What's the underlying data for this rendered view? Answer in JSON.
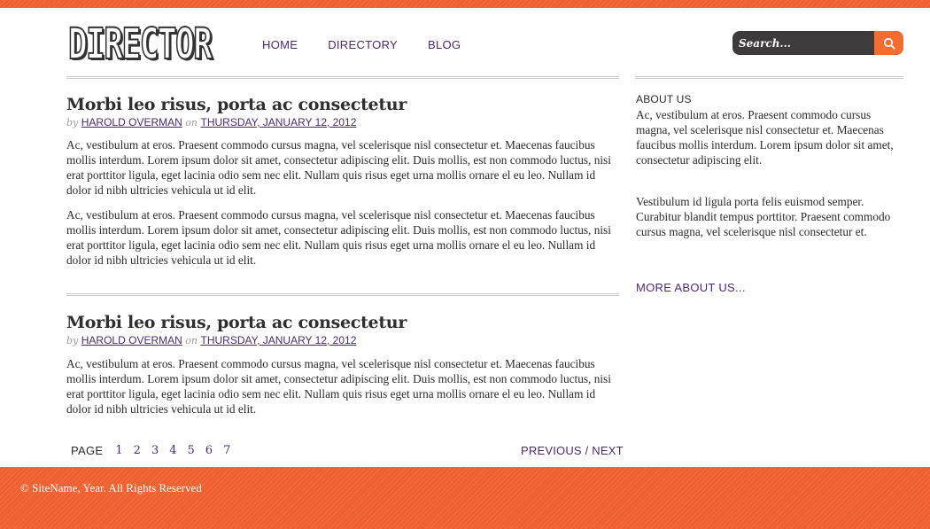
{
  "site": {
    "logo_text": "DIRECTOR"
  },
  "nav": {
    "items": [
      {
        "label": "HOME"
      },
      {
        "label": "DIRECTORY"
      },
      {
        "label": "BLOG"
      }
    ]
  },
  "search": {
    "placeholder": "Search...",
    "icon": "search-icon"
  },
  "posts": [
    {
      "title": "Morbi leo risus, porta ac consectetur",
      "by_word": "by",
      "author": "HAROLD OVERMAN",
      "on_word": "on",
      "date": "THURSDAY, JANUARY 12, 2012",
      "paragraphs": [
        "Ac, vestibulum at eros. Praesent commodo cursus magna, vel scelerisque nisl consectetur et. Maecenas faucibus mollis interdum. Lorem ipsum dolor sit amet, consectetur adipiscing elit. Duis mollis, est non commodo luctus, nisi erat porttitor ligula, eget lacinia odio sem nec elit. Nullam quis risus eget urna mollis ornare el eu leo. Nullam id dolor id nibh ultricies vehicula ut id elit.",
        "Ac, vestibulum at eros. Praesent commodo cursus magna, vel scelerisque nisl consectetur et. Maecenas faucibus mollis interdum. Lorem ipsum dolor sit amet, consectetur adipiscing elit. Duis mollis, est non commodo luctus, nisi erat porttitor ligula, eget lacinia odio sem nec elit. Nullam quis risus eget urna mollis ornare el eu leo. Nullam id dolor id nibh ultricies vehicula ut id elit."
      ]
    },
    {
      "title": "Morbi leo risus, porta ac consectetur",
      "by_word": "by",
      "author": "HAROLD OVERMAN",
      "on_word": "on",
      "date": "THURSDAY, JANUARY 12, 2012",
      "paragraphs": [
        "Ac, vestibulum at eros. Praesent commodo cursus magna, vel scelerisque nisl consectetur et. Maecenas faucibus mollis interdum. Lorem ipsum dolor sit amet, consectetur adipiscing elit. Duis mollis, est non commodo luctus, nisi erat porttitor ligula, eget lacinia odio sem nec elit. Nullam quis risus eget urna mollis ornare el eu leo. Nullam id dolor id nibh ultricies vehicula ut id elit."
      ]
    }
  ],
  "pagination": {
    "label": "PAGE",
    "pages": [
      "1",
      "2",
      "3",
      "4",
      "5",
      "6",
      "7"
    ],
    "previous": "PREVIOUS",
    "separator": "/",
    "next": "NEXT"
  },
  "sidebar": {
    "heading": "ABOUT US",
    "paragraphs": [
      "Ac, vestibulum at eros. Praesent commodo cursus magna, vel scelerisque nisl consectetur et. Maecenas faucibus mollis interdum. Lorem ipsum dolor sit amet, consectetur adipiscing elit.",
      "Vestibulum id ligula porta felis euismod semper. Curabitur blandit tempus porttitor. Praesent commodo cursus magna, vel scelerisque nisl consectetur et."
    ],
    "more_link": "MORE ABOUT US..."
  },
  "footer": {
    "copyright": "© SiteName, Year. All Rights Reserved"
  },
  "colors": {
    "accent": "#f0602e",
    "link": "#4b2b6b",
    "search_bg": "#3d3b3b",
    "text": "#2b2b2b"
  }
}
